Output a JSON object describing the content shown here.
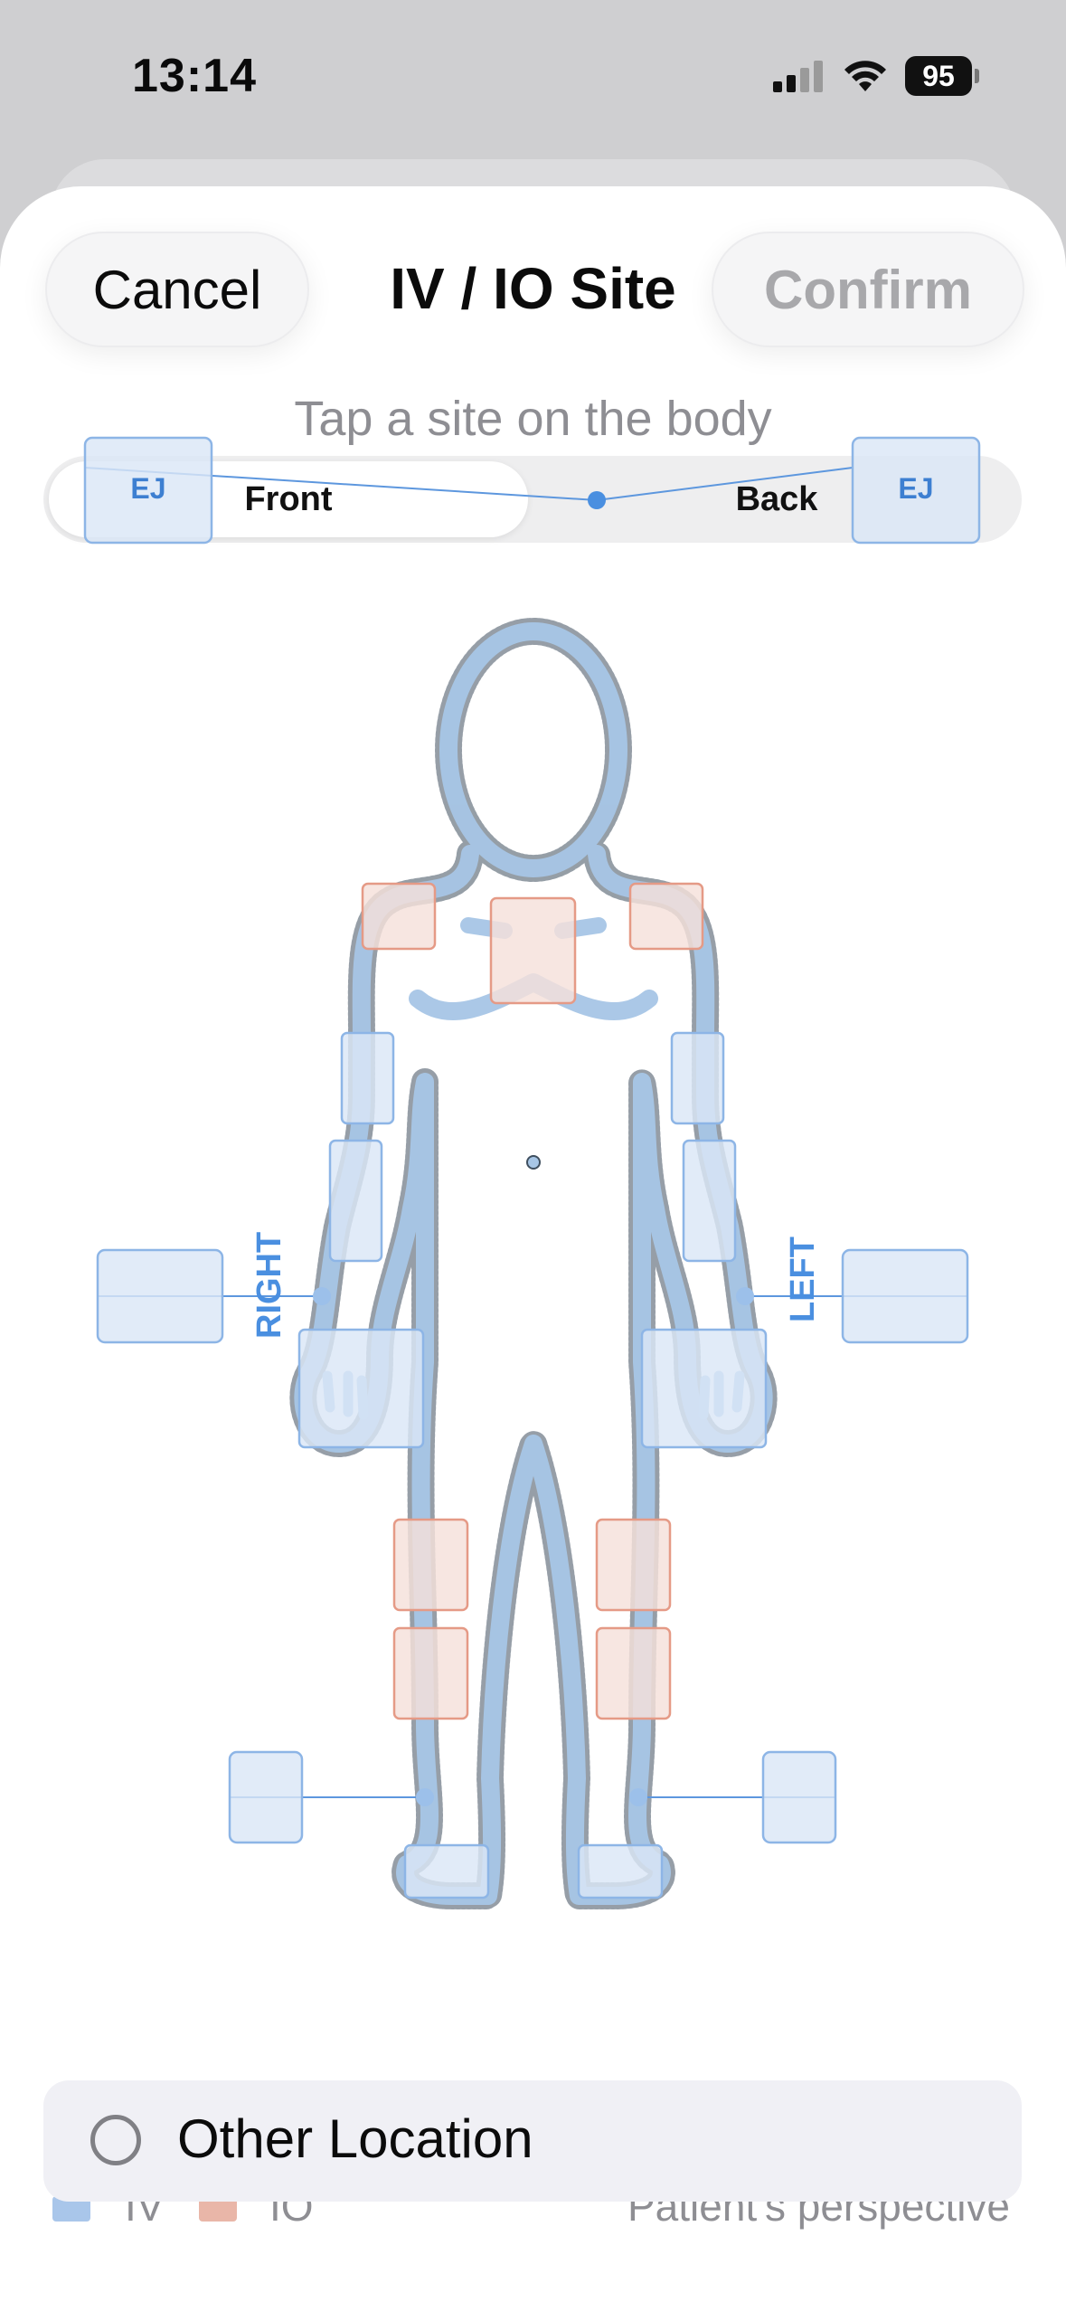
{
  "status": {
    "time": "13:14",
    "battery": "95"
  },
  "header": {
    "cancel_label": "Cancel",
    "title": "IV / IO Site",
    "confirm_label": "Confirm"
  },
  "instruction": "Tap a site on the body",
  "view_toggle": {
    "options": [
      "Front",
      "Back"
    ],
    "selected": "Front"
  },
  "diagram": {
    "side_labels": {
      "right": "RIGHT",
      "left": "LEFT"
    },
    "site_labels": {
      "ej_right": "EJ",
      "ej_left": "EJ"
    }
  },
  "legend": {
    "iv_label": "IV",
    "io_label": "IO",
    "iv_color": "#a9c6ea",
    "io_color": "#e9b6a8",
    "perspective": "Patient's perspective"
  },
  "other_location": {
    "label": "Other Location"
  },
  "colors": {
    "accent": "#4a8fe0",
    "iv_fill": "#dbe7f7",
    "iv_stroke": "#8db5e6",
    "io_fill": "#f5e1db",
    "io_stroke": "#e59a86"
  }
}
